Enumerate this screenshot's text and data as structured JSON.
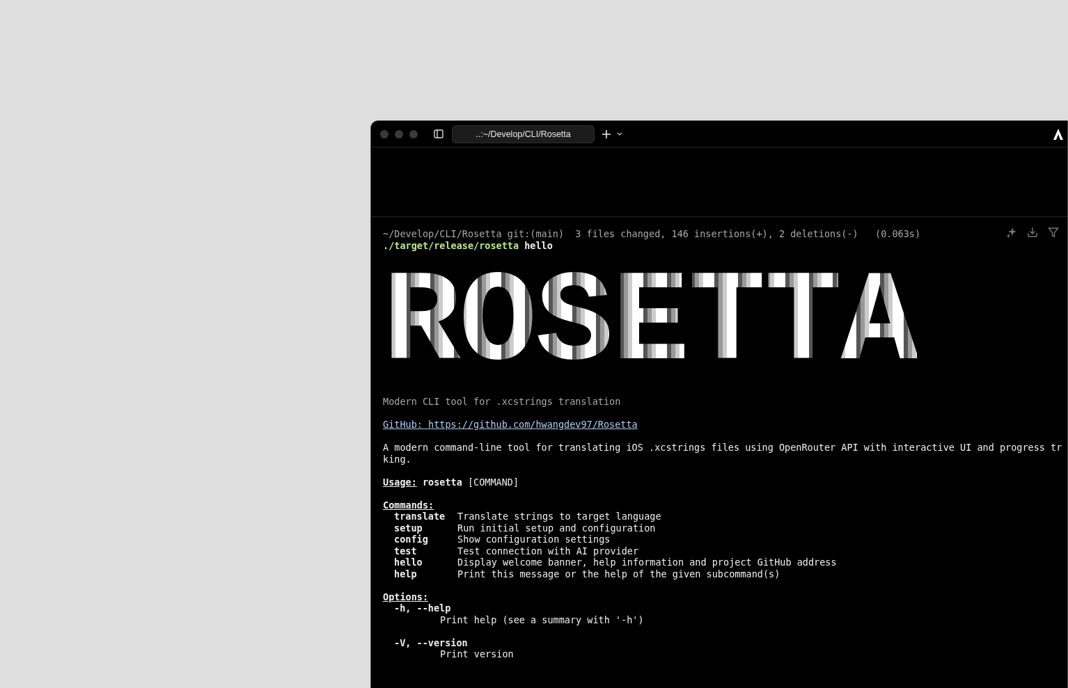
{
  "tab": {
    "title": "..:~/Develop/CLI/Rosetta"
  },
  "prompt": "~/Develop/CLI/Rosetta git:(main)  3 files changed, 146 insertions(+), 2 deletions(-)   (0.063s)",
  "command": {
    "program": "./target/release/rosetta",
    "args": "hello"
  },
  "banner": "ROSETTA",
  "tagline": "Modern CLI tool for .xcstrings translation",
  "github_link": "GitHub: https://github.com/hwangdev97/Rosetta",
  "description_lines": [
    "A modern command-line tool for translating iOS .xcstrings files using OpenRouter API with interactive UI and progress tr",
    "king."
  ],
  "usage": {
    "label": "Usage:",
    "command": "rosetta",
    "args": "[COMMAND]"
  },
  "commands": {
    "title": "Commands:",
    "items": [
      {
        "name": "translate",
        "description": "Translate strings to target language"
      },
      {
        "name": "setup",
        "description": "Run initial setup and configuration"
      },
      {
        "name": "config",
        "description": "Show configuration settings"
      },
      {
        "name": "test",
        "description": "Test connection with AI provider"
      },
      {
        "name": "hello",
        "description": "Display welcome banner, help information and project GitHub address"
      },
      {
        "name": "help",
        "description": "Print this message or the help of the given subcommand(s)"
      }
    ]
  },
  "options": {
    "title": "Options:",
    "items": [
      {
        "flags": "-h, --help",
        "description": "Print help (see a summary with '-h')"
      },
      {
        "flags": "-V, --version",
        "description": "Print version"
      }
    ]
  }
}
